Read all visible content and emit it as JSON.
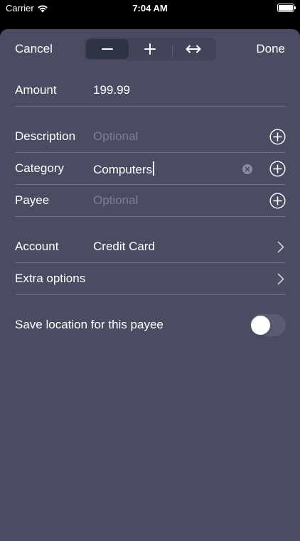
{
  "status_bar": {
    "carrier": "Carrier",
    "time": "7:04 AM"
  },
  "nav": {
    "cancel_label": "Cancel",
    "done_label": "Done",
    "segments": [
      {
        "icon": "minus-icon",
        "selected": true
      },
      {
        "icon": "plus-icon",
        "selected": false
      },
      {
        "icon": "transfer-arrows-icon",
        "selected": false
      }
    ]
  },
  "form": {
    "amount": {
      "label": "Amount",
      "value": "199.99"
    },
    "description": {
      "label": "Description",
      "placeholder": "Optional"
    },
    "category": {
      "label": "Category",
      "value": "Computers"
    },
    "payee": {
      "label": "Payee",
      "placeholder": "Optional"
    },
    "account": {
      "label": "Account",
      "value": "Credit Card"
    },
    "extra_options": {
      "label": "Extra options"
    },
    "save_location": {
      "label": "Save location for this payee",
      "enabled": false
    }
  },
  "colors": {
    "sheet_background": "#4a4d62",
    "separator": "#6c6f83",
    "placeholder": "#7c7f92",
    "selected_segment": "#2f3346"
  }
}
